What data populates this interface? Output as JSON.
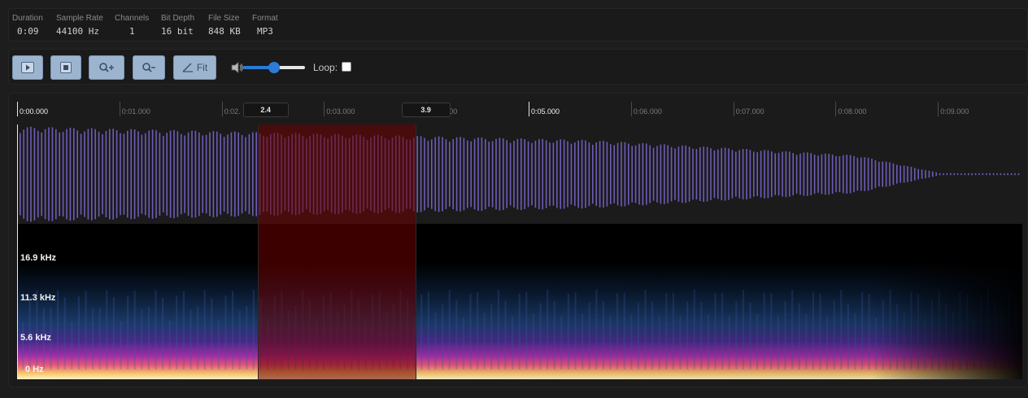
{
  "info": [
    {
      "label": "Duration",
      "value": "0:09"
    },
    {
      "label": "Sample Rate",
      "value": "44100 Hz"
    },
    {
      "label": "Channels",
      "value": "1"
    },
    {
      "label": "Bit Depth",
      "value": "16 bit"
    },
    {
      "label": "File Size",
      "value": "848 KB"
    },
    {
      "label": "Format",
      "value": "MP3"
    }
  ],
  "toolbar": {
    "play_icon": "play-icon",
    "stop_icon": "stop-icon",
    "zoom_in_icon": "zoom-in-icon",
    "zoom_out_icon": "zoom-out-icon",
    "fit_label": "Fit",
    "volume": 0.5,
    "loop_label": "Loop:",
    "loop_checked": false
  },
  "ruler": {
    "ticks": [
      "0:00.000",
      "0:01.000",
      "0:02.",
      "0:03.000",
      "0:04.000",
      "0:05.000",
      "0:06.000",
      "0:07.000",
      "0:08.000",
      "0:09.000"
    ],
    "major_ticks": [
      "0:00.000",
      "0:05.000"
    ],
    "selection_start_label": "2.4",
    "selection_end_label": "3.9"
  },
  "selection": {
    "start_sec": 2.35,
    "end_sec": 3.9
  },
  "spectrogram": {
    "freq_labels": [
      "16.9 kHz",
      "11.3 kHz",
      "5.6 kHz",
      "0 Hz"
    ]
  },
  "colors": {
    "waveform": "#6f5bb8",
    "selection": "#6e0000",
    "accent": "#2b7bd8",
    "button": "#9db4cf"
  }
}
